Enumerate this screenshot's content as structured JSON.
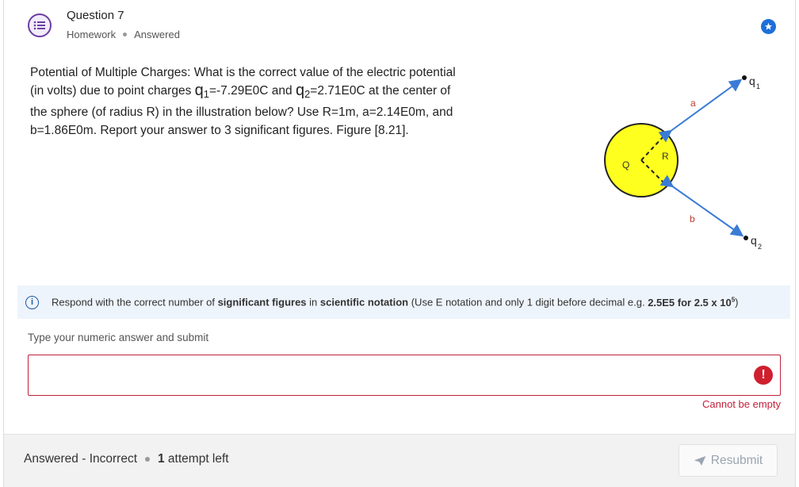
{
  "header": {
    "title": "Question 7",
    "type": "Homework",
    "state": "Answered"
  },
  "question": {
    "text_before": "Potential of Multiple Charges: What is the correct value of the electric potential (in volts) due to point charges ",
    "q1_symbol": "q",
    "q1_sub": "1",
    "q1_value": "=-7.29E0C and ",
    "q2_symbol": "q",
    "q2_sub": "2",
    "q2_value": "=2.71E0C at the center of the sphere (of radius R) in the illustration below? Use R=1m, a=2.14E0m, and b=1.86E0m. Report your answer to 3 significant figures. Figure [8.21]."
  },
  "figure": {
    "label_q": "Q",
    "label_r": "R",
    "label_a": "a",
    "label_b": "b",
    "label_q1": "q",
    "label_q1_sub": "1",
    "label_q2": "q",
    "label_q2_sub": "2",
    "sphere_color": "#ffff1f",
    "arrow_color": "#3a7bd5"
  },
  "info": {
    "prefix": "Respond with the correct number of ",
    "sigfigs": "significant figures",
    "mid": " in ",
    "notation": "scientific notation",
    "suffix": " (Use E notation and only 1 digit before decimal e.g. ",
    "example": "2.5E5 for 2.5 x 10",
    "example_exp": "5",
    "close": ")"
  },
  "answer": {
    "label": "Type your numeric answer and submit",
    "value": "",
    "placeholder": "",
    "error": "Cannot be empty",
    "error_icon": "!"
  },
  "footer": {
    "status": "Answered - Incorrect",
    "attempts_count": "1",
    "attempts_text": " attempt left",
    "resubmit_label": "Resubmit"
  },
  "colors": {
    "accent": "#1e6fd9",
    "error": "#c0213a",
    "info_bg": "#eef4fb",
    "question_icon": "#6b3fa0"
  }
}
